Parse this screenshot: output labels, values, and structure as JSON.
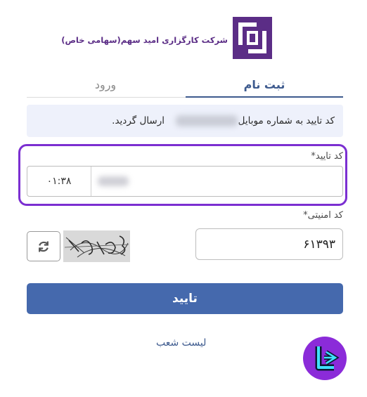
{
  "header": {
    "company_name": "شرکت کارگزاری امید سهم(سهامی خاص)",
    "logo_icon": "company-logo-icon"
  },
  "tabs": [
    {
      "label": "ثبت نام",
      "active": true
    },
    {
      "label": "ورود",
      "active": false
    }
  ],
  "alert": {
    "text_before": "کد تایید به شماره موبایل",
    "text_after": "ارسال گردید."
  },
  "verification": {
    "label": "کد تایید",
    "required_mark": "*",
    "timer": "۰۱:۳۸"
  },
  "security": {
    "label": "کد امنیتی",
    "required_mark": "*",
    "value": "۶۱۳۹۳",
    "refresh_icon": "refresh-icon"
  },
  "actions": {
    "submit_label": "تایید",
    "branches_link": "لیست شعب"
  },
  "colors": {
    "accent": "#4569ad",
    "highlight": "#7b2fd1",
    "brand": "#5b2d86",
    "alert_bg": "#eef1fb"
  }
}
